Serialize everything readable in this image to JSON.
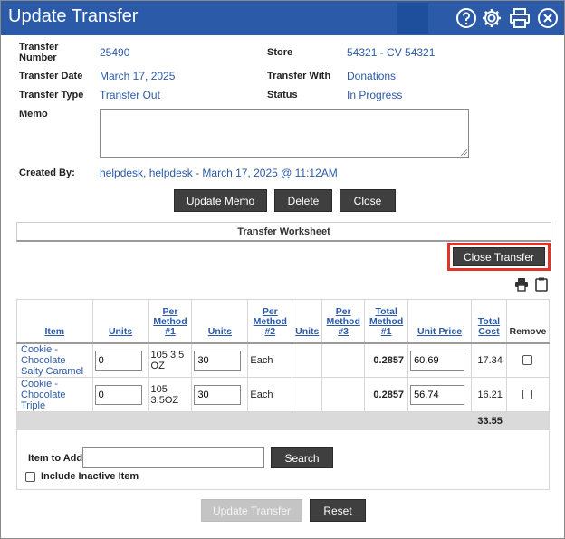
{
  "window": {
    "title": "Update Transfer",
    "icons": [
      "help-icon",
      "gear-icon",
      "print-icon",
      "close-icon"
    ]
  },
  "form": {
    "transfer_number_label": "Transfer Number",
    "transfer_number": "25490",
    "store_label": "Store",
    "store": "54321 - CV 54321",
    "transfer_date_label": "Transfer Date",
    "transfer_date": "March 17, 2025",
    "transfer_with_label": "Transfer With",
    "transfer_with": "Donations",
    "transfer_type_label": "Transfer Type",
    "transfer_type": "Transfer Out",
    "status_label": "Status",
    "status": "In Progress",
    "memo_label": "Memo",
    "memo_value": "",
    "created_by_label": "Created By:",
    "created_by": "helpdesk, helpdesk - March 17, 2025 @ 11:12AM"
  },
  "actions": {
    "update_memo": "Update Memo",
    "delete": "Delete",
    "close": "Close"
  },
  "worksheet": {
    "title": "Transfer Worksheet",
    "close_transfer": "Close Transfer",
    "columns": {
      "item": "Item",
      "units1": "Units",
      "per_method_1": "Per Method #1",
      "units2": "Units",
      "per_method_2": "Per Method #2",
      "units3": "Units",
      "per_method_3": "Per Method #3",
      "total_method_1": "Total Method #1",
      "unit_price": "Unit Price",
      "total_cost": "Total Cost",
      "remove": "Remove"
    },
    "rows": [
      {
        "item": "Cookie - Chocolate Salty Caramel",
        "units1": "0",
        "per_method_1": "105 3.5 OZ",
        "units2": "30",
        "per_method_2": "Each",
        "total_method_1": "0.2857",
        "unit_price": "60.69",
        "total_cost": "17.34"
      },
      {
        "item": "Cookie - Chocolate Triple",
        "units1": "0",
        "per_method_1": "105 3.5OZ",
        "units2": "30",
        "per_method_2": "Each",
        "total_method_1": "0.2857",
        "unit_price": "56.74",
        "total_cost": "16.21"
      }
    ],
    "grand_total": "33.55",
    "item_to_add_label": "Item to Add:",
    "item_to_add_value": "",
    "search": "Search",
    "include_inactive": "Include Inactive Item"
  },
  "footer": {
    "update_transfer": "Update Transfer",
    "reset": "Reset"
  },
  "colors": {
    "header_bg": "#2b5aa8",
    "link": "#2b5aa8",
    "button_bg": "#3f3f3f",
    "highlight": "#e23426"
  }
}
